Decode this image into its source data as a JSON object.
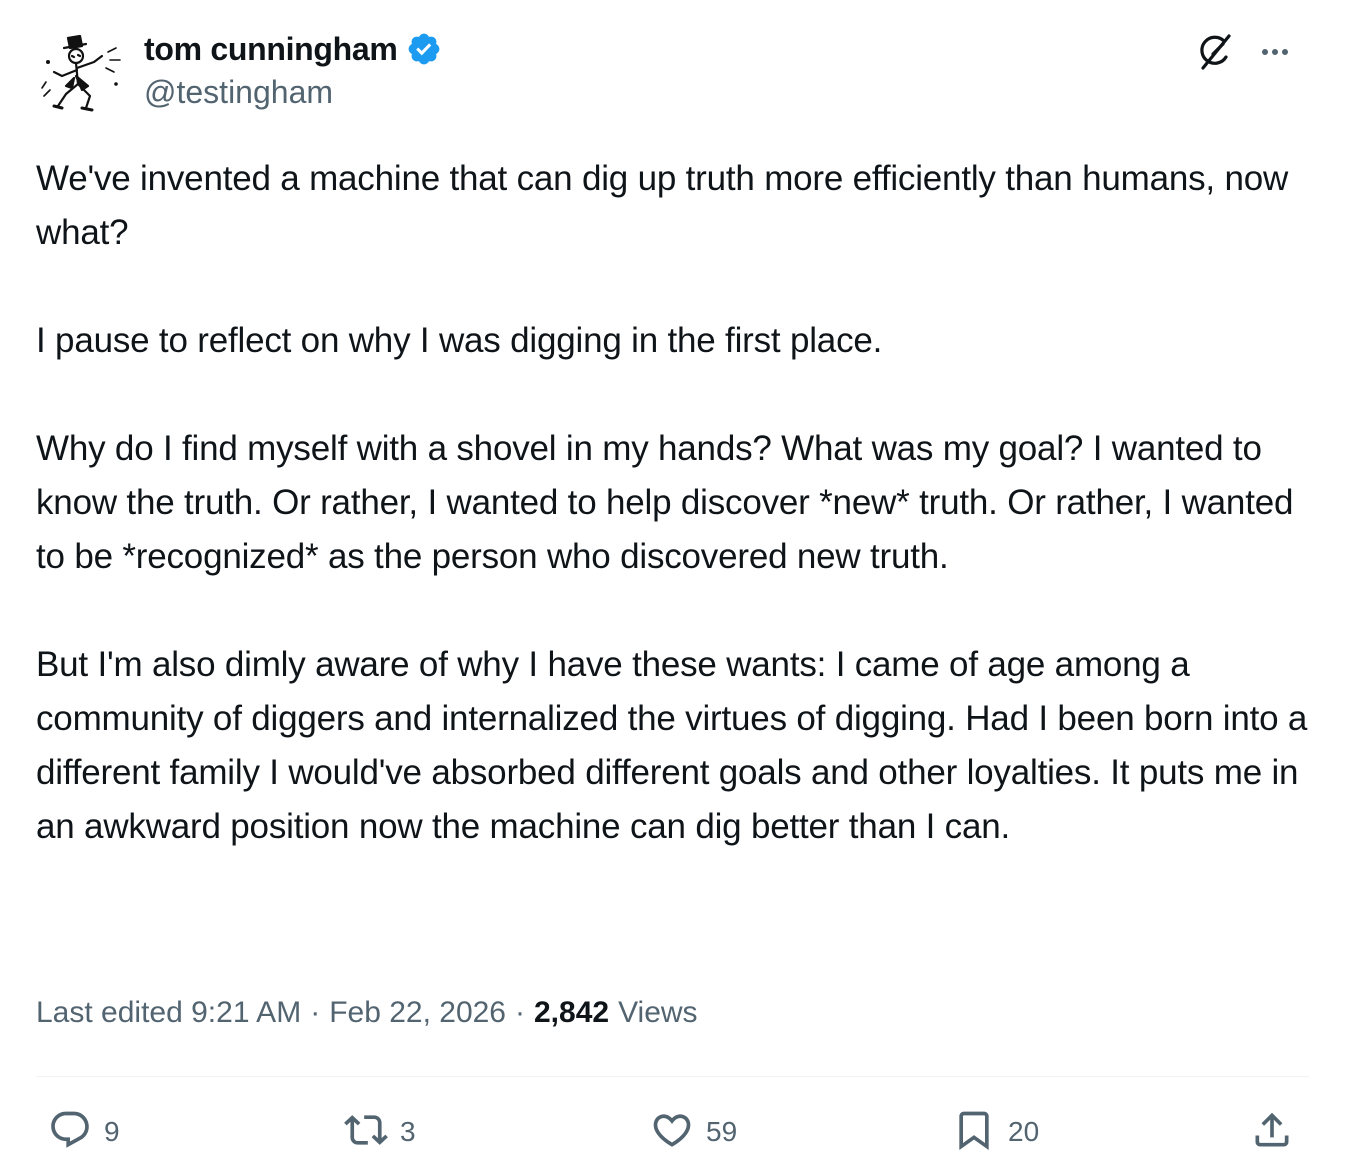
{
  "author": {
    "display_name": "tom cunningham",
    "handle": "@testingham",
    "verified": true,
    "verified_color": "#1d9bf0"
  },
  "header_icons": [
    "grok-icon",
    "more-options-icon"
  ],
  "tweet": {
    "text": "We've invented a machine that can dig up truth more efficiently than humans, now what?\n\nI pause to reflect on why I was digging in the first place.\n\nWhy do I find myself with a shovel in my hands? What was my goal? I wanted to know the truth. Or rather, I wanted to help discover *new* truth. Or rather, I wanted to be *recognized* as the person who discovered new truth.\n\nBut I'm also dimly aware of why I have these wants: I came of age among a community of diggers and internalized the virtues of digging. Had I been born into a different family I would've absorbed different goals and other loyalties. It puts me in an awkward position now the machine can dig better than I can."
  },
  "meta": {
    "edited_label": "Last edited 9:21 AM",
    "separator": "·",
    "date": "Feb 22, 2026",
    "views_count": "2,842",
    "views_label": "Views"
  },
  "actions": {
    "reply_count": "9",
    "retweet_count": "3",
    "like_count": "59",
    "bookmark_count": "20"
  },
  "colors": {
    "text_primary": "#0f1419",
    "text_secondary": "#536471",
    "divider": "#eff3f4"
  }
}
